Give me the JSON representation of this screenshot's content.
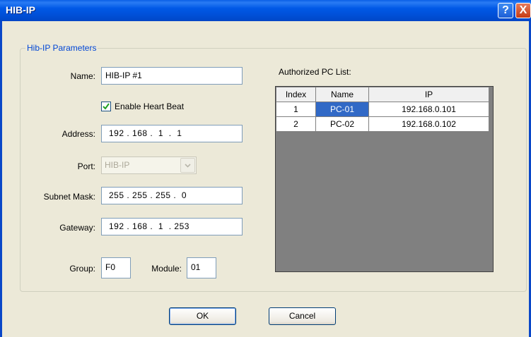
{
  "window": {
    "title": "HIB-IP",
    "help_glyph": "?",
    "close_glyph": "X"
  },
  "group": {
    "title": "Hib-IP Parameters"
  },
  "form": {
    "name_label": "Name:",
    "name_value": "HIB-IP #1",
    "heartbeat_label": "Enable Heart Beat",
    "heartbeat_checked": true,
    "address_label": "Address:",
    "address_value": "192 . 168 .  1  .  1",
    "port_label": "Port:",
    "port_value": "HIB-IP",
    "subnet_label": "Subnet Mask:",
    "subnet_value": "255 . 255 . 255 .  0",
    "gateway_label": "Gateway:",
    "gateway_value": "192 . 168 .  1  . 253",
    "group_label": "Group:",
    "group_value": "F0",
    "module_label": "Module:",
    "module_value": "01"
  },
  "pc_list": {
    "title": "Authorized PC List:",
    "columns": [
      "Index",
      "Name",
      "IP"
    ],
    "rows": [
      {
        "index": "1",
        "name": "PC-01",
        "ip": "192.168.0.101"
      },
      {
        "index": "2",
        "name": "PC-02",
        "ip": "192.168.0.102"
      }
    ]
  },
  "buttons": {
    "ok": "OK",
    "cancel": "Cancel"
  }
}
